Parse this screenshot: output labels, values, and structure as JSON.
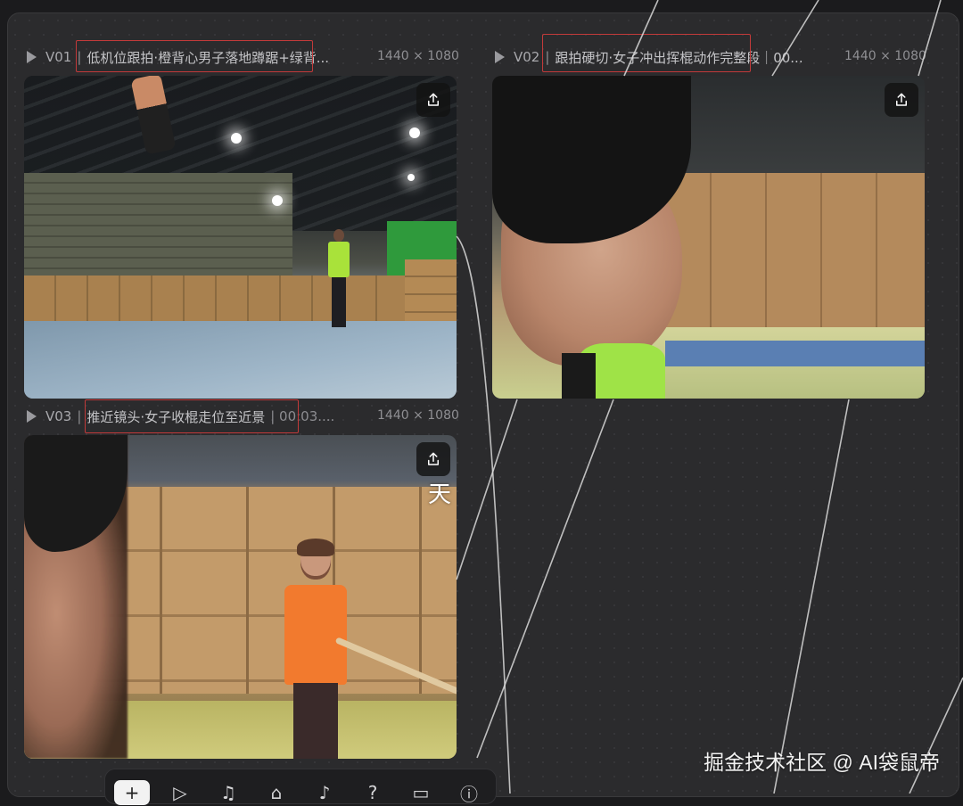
{
  "clips": [
    {
      "id": "V01",
      "separator": "|",
      "title": "低机位跟拍·橙背心男子落地蹲踞+绿背...",
      "resolution": "1440 × 1080"
    },
    {
      "id": "V02",
      "separator": "|",
      "title": "跟拍硬切·女子冲出挥棍动作完整段｜00...",
      "resolution": "1440 × 1080"
    },
    {
      "id": "V03",
      "separator": "|",
      "title": "推近镜头·女子收棍走位至近景",
      "title_suffix": "| 00:03....",
      "resolution": "1440 × 1080",
      "caption": "天"
    }
  ],
  "toolbar": {
    "tools": [
      {
        "name": "add",
        "glyph": "+"
      },
      {
        "name": "send",
        "glyph": "▷"
      },
      {
        "name": "music",
        "glyph": "♫"
      },
      {
        "name": "home",
        "glyph": "⌂"
      },
      {
        "name": "audio",
        "glyph": "♪"
      },
      {
        "name": "help",
        "glyph": "?"
      },
      {
        "name": "frame",
        "glyph": "▭"
      },
      {
        "name": "info",
        "glyph": "ⓘ"
      }
    ]
  },
  "watermark": "掘金技术社区 @ AI袋鼠帝",
  "colors": {
    "background": "#1b1b1d",
    "panel": "#2b2b2d",
    "highlight_border": "#c23a3a",
    "wire": "#d9d9d9"
  },
  "icons": {
    "play": "play-triangle-icon",
    "share": "share-upload-icon"
  }
}
